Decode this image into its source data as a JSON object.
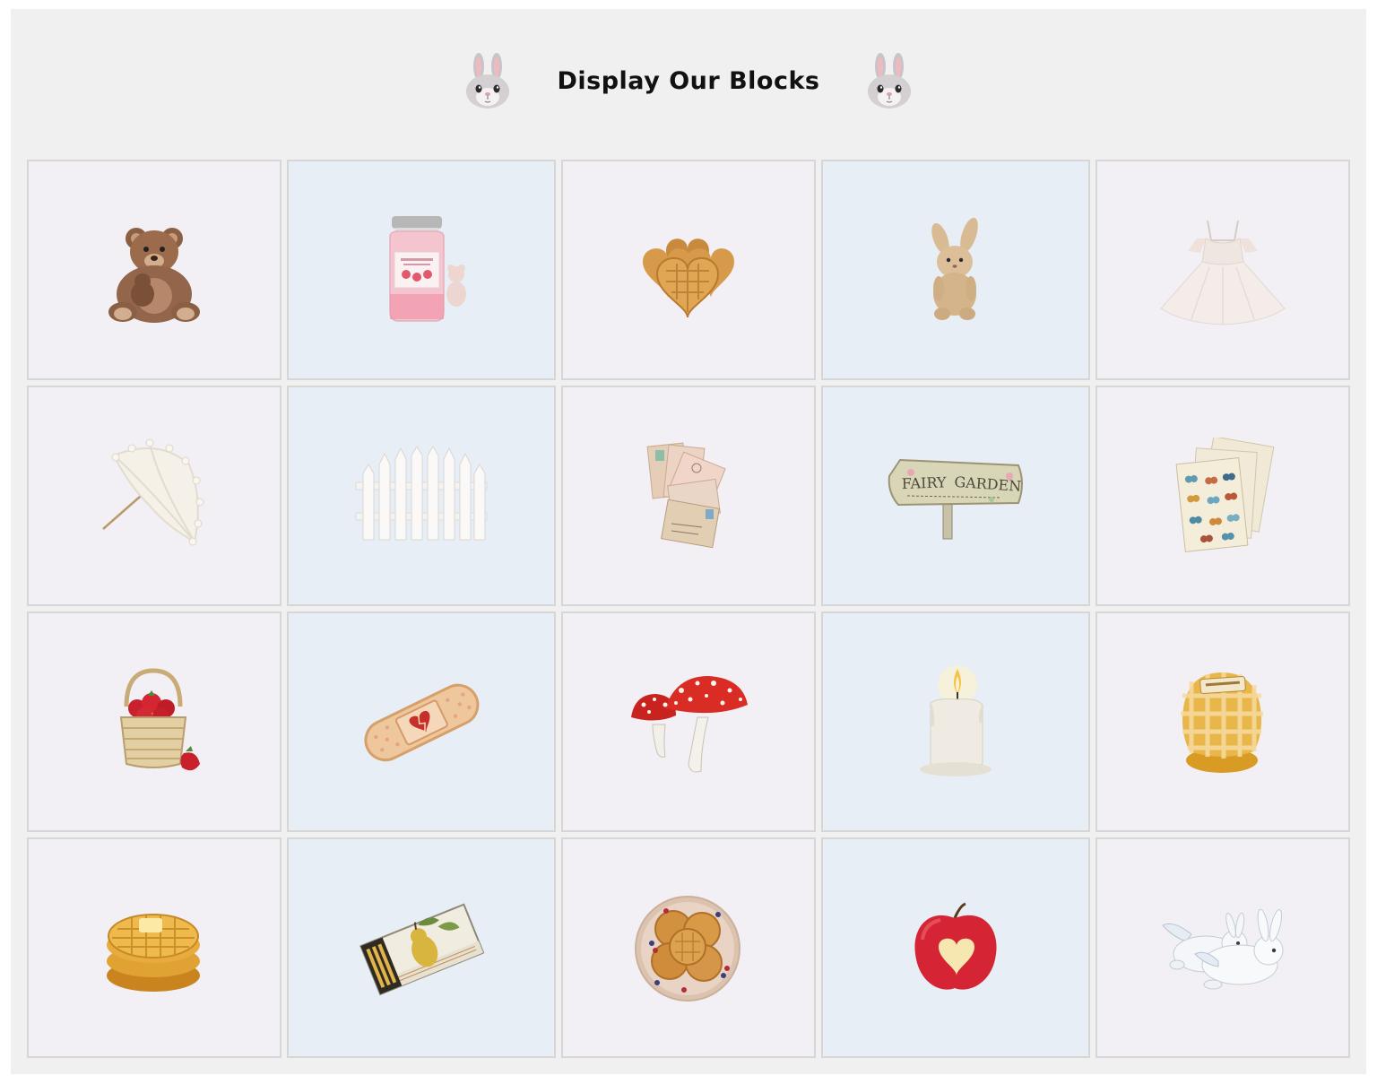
{
  "page": {
    "title": "Display Our Blocks"
  },
  "header": {
    "left_icon": "bunny-face-icon",
    "right_icon": "bunny-face-icon"
  },
  "colors": {
    "page_bg": "#f0f0f0",
    "cell_bg_light": "#f2f0f4",
    "cell_bg_blue": "#e8eef5",
    "cell_border": "#d6d6d6"
  },
  "blocks": [
    {
      "item": "teddy-bear-icon"
    },
    {
      "item": "strawberry-candle-jar-icon"
    },
    {
      "item": "heart-waffles-icon"
    },
    {
      "item": "plush-bunny-icon"
    },
    {
      "item": "white-dress-icon"
    },
    {
      "item": "lace-parasol-icon"
    },
    {
      "item": "white-picket-fence-icon"
    },
    {
      "item": "vintage-postcards-icon"
    },
    {
      "item": "fairy-garden-sign-icon"
    },
    {
      "item": "butterfly-sticker-sheets-icon"
    },
    {
      "item": "strawberry-basket-icon"
    },
    {
      "item": "heart-bandage-icon"
    },
    {
      "item": "red-mushrooms-icon"
    },
    {
      "item": "lit-candle-icon"
    },
    {
      "item": "honey-jar-icon"
    },
    {
      "item": "waffle-stack-icon"
    },
    {
      "item": "pear-matchbox-icon"
    },
    {
      "item": "waffle-plate-icon"
    },
    {
      "item": "heart-apple-icon"
    },
    {
      "item": "flying-bunnies-icon"
    }
  ]
}
